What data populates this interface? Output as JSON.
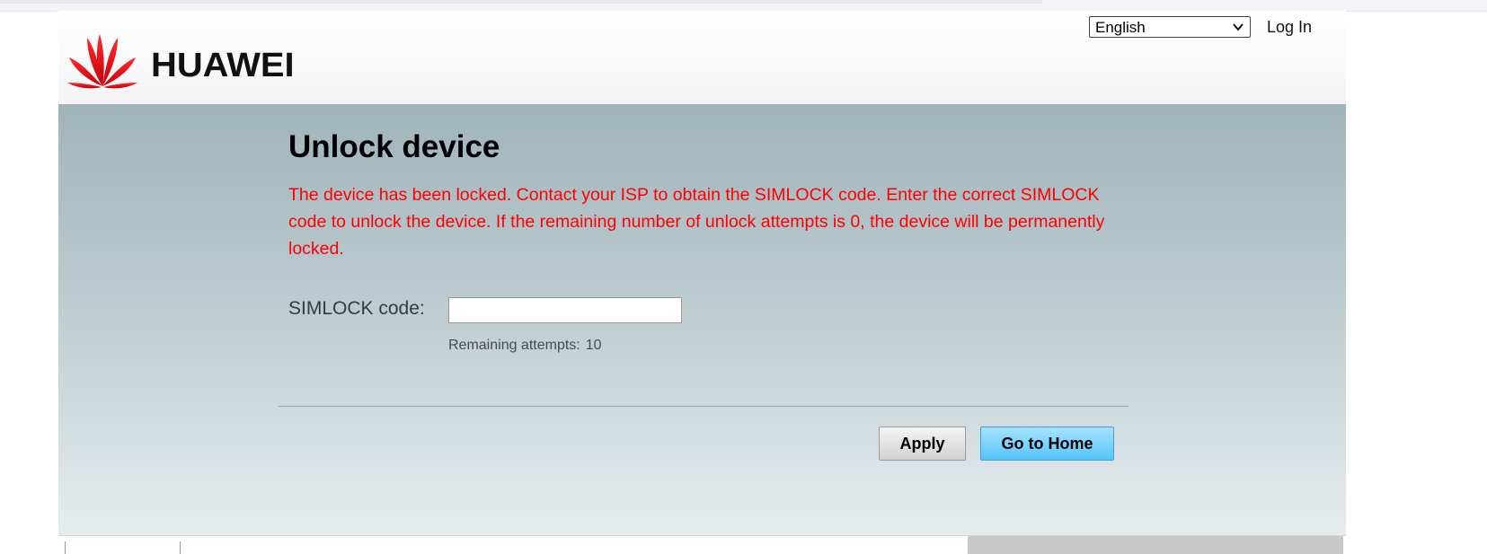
{
  "header": {
    "brand": "HUAWEI",
    "language": {
      "selected": "English"
    },
    "login_label": "Log In"
  },
  "main": {
    "title": "Unlock device",
    "warning": "The device has been locked. Contact your ISP to obtain the SIMLOCK code. Enter the correct SIMLOCK code to unlock the device. If the remaining number of unlock attempts is 0, the device will be permanently locked.",
    "code_label": "SIMLOCK code:",
    "code_value": "",
    "remaining_label": "Remaining attempts:",
    "remaining_count": "10",
    "apply_label": "Apply",
    "home_label": "Go to Home"
  },
  "colors": {
    "warning_text": "#ff0000",
    "logo_red": "#e1000f",
    "primary_button": "#5ec8f8"
  },
  "icons": {
    "logo": "huawei-petal-logo",
    "dropdown": "chevron-down-icon"
  }
}
